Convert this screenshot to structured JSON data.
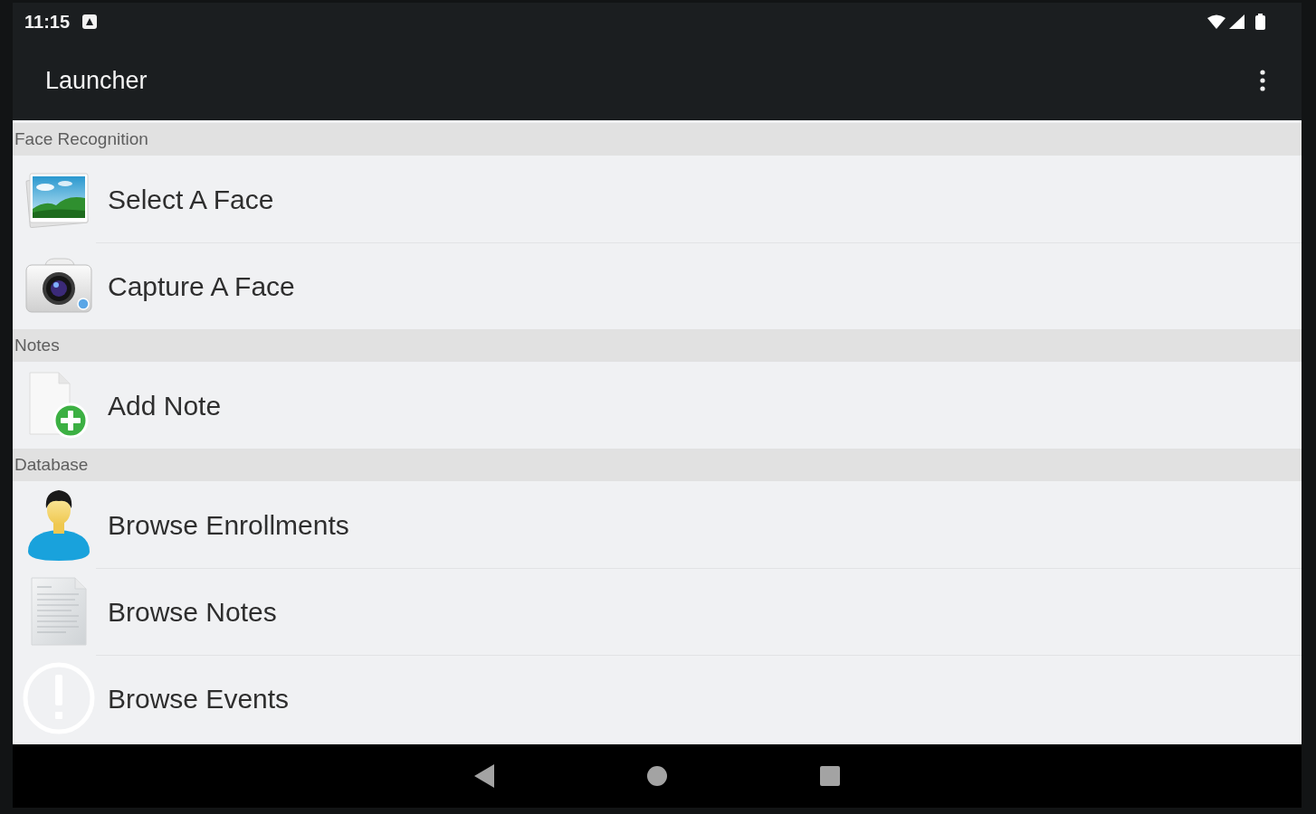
{
  "status_bar": {
    "time": "11:15"
  },
  "app_bar": {
    "title": "Launcher"
  },
  "sections": [
    {
      "title": "Face Recognition",
      "items": [
        {
          "label": "Select A Face",
          "kind": "gallery"
        },
        {
          "label": "Capture A Face",
          "kind": "camera"
        }
      ]
    },
    {
      "title": "Notes",
      "items": [
        {
          "label": "Add Note",
          "kind": "add_note"
        }
      ]
    },
    {
      "title": "Database",
      "items": [
        {
          "label": "Browse Enrollments",
          "kind": "person"
        },
        {
          "label": "Browse Notes",
          "kind": "document"
        },
        {
          "label": "Browse Events",
          "kind": "alert"
        }
      ]
    }
  ]
}
